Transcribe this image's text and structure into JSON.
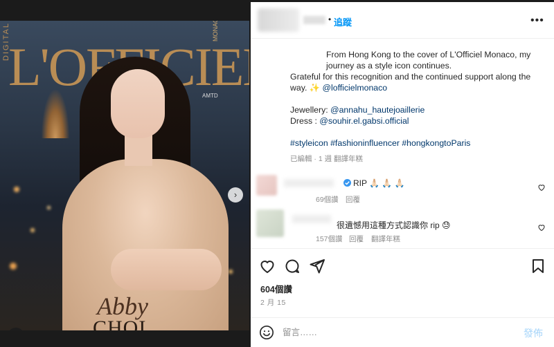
{
  "colors": {
    "accent": "#0095f6",
    "text": "#262626",
    "muted": "#8e8e8e",
    "link": "#00376b",
    "rip_verified": "#3897f0"
  },
  "media": {
    "magazine_title": "L'OFFICIEL",
    "magazine_side": "DIGITAL",
    "magazine_edition": "MONACO",
    "magazine_sponsor": "AMTD",
    "cover_name_script": "Abby",
    "cover_name_caps": "CHOI",
    "next_icon": "chevron-right-icon",
    "tag_icon": "user-tag-icon"
  },
  "header": {
    "separator": "•",
    "follow_label": "追蹤",
    "more_icon": "more-horizontal-icon"
  },
  "caption": {
    "line1": "From Hong Kong to the cover of L'Officiel Monaco, my journey as a style icon continues.",
    "line2_text": "Grateful for this recognition and the continued support along the way. ✨ ",
    "line2_mention": "@lofficielmonaco",
    "jewellery_label": "Jewellery: ",
    "jewellery_mention": "@annahu_hautejoaillerie",
    "dress_label": "Dress : ",
    "dress_mention": "@souhir.el.gabsi.official",
    "hashtags": "#styleicon #fashioninfluencer #hongkongtoParis",
    "meta": "已編輯 · 1 週    翻譯年糕"
  },
  "comments": [
    {
      "text": "RIP 🙏🏻 🙏🏻 🙏🏻",
      "likes": "69個讚",
      "reply": "回覆",
      "translate": ""
    },
    {
      "text": "很遺憾用這種方式認識你 rip 😓",
      "likes": "157個讚",
      "reply": "回覆",
      "translate": "翻譯年糕"
    }
  ],
  "actions": {
    "like_icon": "heart-icon",
    "comment_icon": "comment-icon",
    "share_icon": "send-icon",
    "save_icon": "bookmark-icon"
  },
  "likes_count": "604個讚",
  "post_date": "2 月 15",
  "composer": {
    "emoji_icon": "emoji-icon",
    "placeholder": "留言……",
    "post_label": "發佈"
  }
}
